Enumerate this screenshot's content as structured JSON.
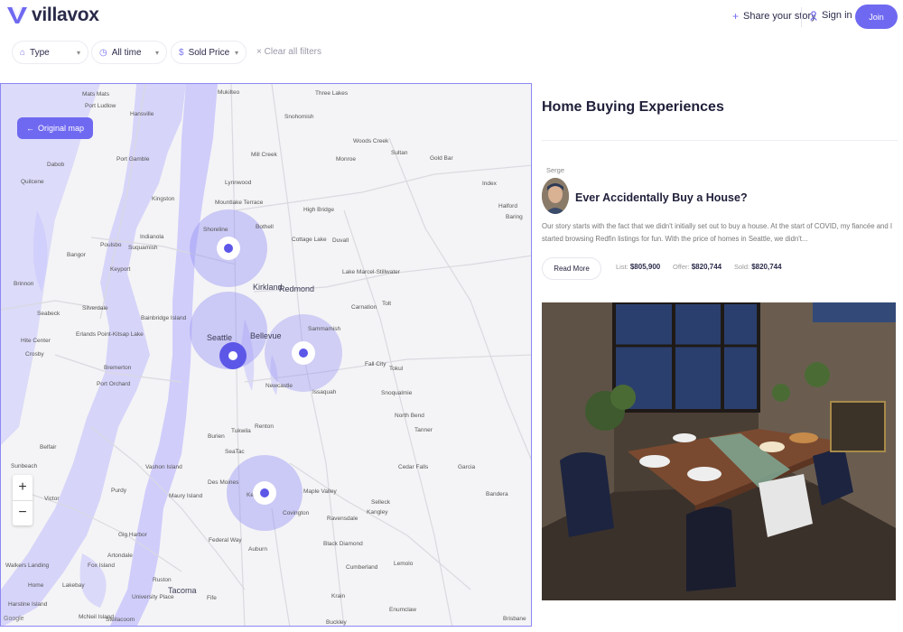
{
  "header": {
    "brand": "villavox",
    "share_label": "Share your story",
    "signin_label": "Sign in",
    "join_label": "Join"
  },
  "filters": {
    "type_label": "Type",
    "time_label": "All time",
    "price_label": "Sold Price",
    "clear_label": "Clear all filters"
  },
  "map": {
    "original_map_label": "Original map",
    "zoom_in": "+",
    "zoom_out": "−",
    "attribution": "Google",
    "towns": [
      "Mats Mats",
      "Port Ludlow",
      "Hansville",
      "Mukilteo",
      "Three Lakes",
      "Snohomish",
      "Dabob",
      "Port Gamble",
      "Mill Creek",
      "Woods Creek",
      "Sultan",
      "Gold Bar",
      "Quilcene",
      "Brinnon",
      "Seabeck",
      "Bangor",
      "Poulsbo",
      "Suquamish",
      "Indianola",
      "Keyport",
      "Kingston",
      "Mountlake Terrace",
      "Lynnwood",
      "Shoreline",
      "Bothell",
      "High Bridge",
      "Cottage Lake",
      "Duvall",
      "Monroe",
      "Index",
      "Halford",
      "Baring",
      "Silverdale",
      "Erlands Point-Kitsap Lake",
      "Bainbridge Island",
      "Hite Center",
      "Crosby",
      "Bremerton",
      "Port Orchard",
      "Kirkland",
      "Redmond",
      "Lake Marcel-Stillwater",
      "Carnation",
      "Seattle",
      "Bellevue",
      "Sammamish",
      "Newcastle",
      "Issaquah",
      "Fall City",
      "Tokul",
      "Snoqualmie",
      "North Bend",
      "Tanner",
      "Tukwila",
      "Renton",
      "Burien",
      "SeaTac",
      "Vashon Island",
      "Belfair",
      "Sunbeach",
      "Victor",
      "Purdy",
      "Maury Island",
      "Des Moines",
      "Kent",
      "Maple Valley",
      "Covington",
      "Cedar Falls",
      "Garcia",
      "Selleck",
      "Kangley",
      "Ravensdale",
      "Gig Harbor",
      "Artondale",
      "Federal Way",
      "Black Diamond",
      "Auburn",
      "Cumberland",
      "Lemolo",
      "Walkers Landing",
      "Home",
      "Lakebay",
      "Harstine Island",
      "Fox Island",
      "Ruston",
      "Tacoma",
      "University Place",
      "Fife",
      "Krain",
      "Enumclaw",
      "Buckley",
      "McNeil Island",
      "Steilacoom",
      "Brisbane",
      "Bandera",
      "Tolt"
    ]
  },
  "panel": {
    "title": "Home Buying Experiences",
    "author": "Serge",
    "story_title": "Ever Accidentally Buy a House?",
    "story_text": "Our story starts with the fact that we didn't initially set out to buy a house. At the start of COVID, my fiancée and I started browsing Redfin listings for fun. With the price of homes in Seattle, we didn't...",
    "read_more": "Read More",
    "list_label": "List:",
    "list_value": "$805,900",
    "offer_label": "Offer:",
    "offer_value": "$820,744",
    "sold_label": "Sold:",
    "sold_value": "$820,744"
  },
  "colors": {
    "accent": "#6f69f1",
    "circle": "#9a95f5",
    "water": "#c6c4fa"
  }
}
